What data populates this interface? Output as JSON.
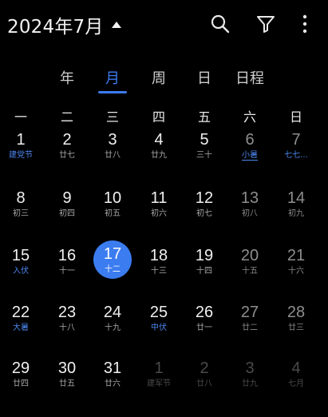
{
  "header": {
    "month_title": "2024年7月",
    "icons": [
      "search-icon",
      "filter-icon",
      "more-vert-icon"
    ]
  },
  "view_tabs": [
    {
      "label": "年",
      "active": false
    },
    {
      "label": "月",
      "active": true
    },
    {
      "label": "周",
      "active": false
    },
    {
      "label": "日",
      "active": false
    },
    {
      "label": "日程",
      "active": false
    }
  ],
  "weekdays": [
    "一",
    "二",
    "三",
    "四",
    "五",
    "六",
    "日"
  ],
  "weeks": [
    [
      {
        "day": "1",
        "sub": "建党节",
        "holiday": true
      },
      {
        "day": "2",
        "sub": "廿七"
      },
      {
        "day": "3",
        "sub": "廿八"
      },
      {
        "day": "4",
        "sub": "廿九"
      },
      {
        "day": "5",
        "sub": "三十"
      },
      {
        "day": "6",
        "sub": "小暑",
        "holiday": true,
        "underline": true
      },
      {
        "day": "7",
        "sub": "七七...",
        "holiday": true
      }
    ],
    [
      {
        "day": "8",
        "sub": "初三"
      },
      {
        "day": "9",
        "sub": "初四"
      },
      {
        "day": "10",
        "sub": "初五"
      },
      {
        "day": "11",
        "sub": "初六"
      },
      {
        "day": "12",
        "sub": "初七"
      },
      {
        "day": "13",
        "sub": "初八"
      },
      {
        "day": "14",
        "sub": "初九"
      }
    ],
    [
      {
        "day": "15",
        "sub": "入伏",
        "holiday": true
      },
      {
        "day": "16",
        "sub": "十一"
      },
      {
        "day": "17",
        "sub": "十二",
        "today": true
      },
      {
        "day": "18",
        "sub": "十三"
      },
      {
        "day": "19",
        "sub": "十四"
      },
      {
        "day": "20",
        "sub": "十五"
      },
      {
        "day": "21",
        "sub": "十六"
      }
    ],
    [
      {
        "day": "22",
        "sub": "大暑",
        "holiday": true
      },
      {
        "day": "23",
        "sub": "十八"
      },
      {
        "day": "24",
        "sub": "十九"
      },
      {
        "day": "25",
        "sub": "中伏",
        "holiday": true
      },
      {
        "day": "26",
        "sub": "廿一"
      },
      {
        "day": "27",
        "sub": "廿二"
      },
      {
        "day": "28",
        "sub": "廿三"
      }
    ],
    [
      {
        "day": "29",
        "sub": "廿四"
      },
      {
        "day": "30",
        "sub": "廿五"
      },
      {
        "day": "31",
        "sub": "廿六"
      },
      {
        "day": "1",
        "sub": "建军节",
        "other": true
      },
      {
        "day": "2",
        "sub": "廿八",
        "other": true
      },
      {
        "day": "3",
        "sub": "廿九",
        "other": true
      },
      {
        "day": "4",
        "sub": "七月",
        "other": true
      }
    ]
  ],
  "colors": {
    "accent": "#3b7cf0",
    "background": "#000000"
  }
}
